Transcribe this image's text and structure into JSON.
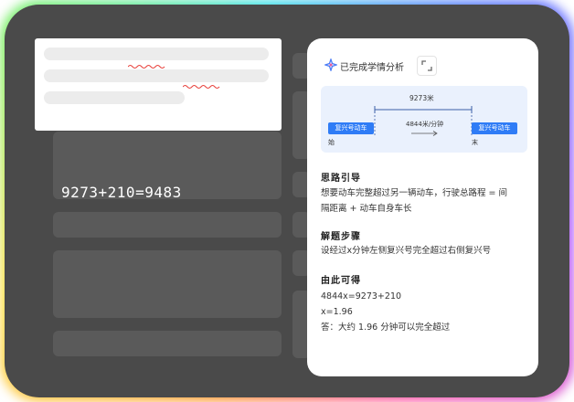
{
  "canvas": {
    "equation": "9273+210=9483"
  },
  "panel": {
    "status": "已完成学情分析",
    "diagram": {
      "total_distance": "9273米",
      "speed_label": "4844米/分钟",
      "left_train": "复兴号动车",
      "right_train": "复兴号动车",
      "start_label": "始",
      "end_label": "末"
    },
    "sections": [
      {
        "heading": "思路引导",
        "lines": [
          "想要动车完整超过另一辆动车，行驶总路程 = 间",
          "隔距离 + 动车自身车长"
        ]
      },
      {
        "heading": "解题步骤",
        "lines": [
          "设经过x分钟左侧复兴号完全超过右侧复兴号"
        ]
      },
      {
        "heading": "由此可得",
        "lines": [
          "4844x=9273+210",
          "x=1.96",
          "答：大约 1.96 分钟可以完全超过"
        ]
      }
    ]
  },
  "colors": {
    "accent": "#2f7cf6",
    "error_underline": "#e8423c"
  }
}
